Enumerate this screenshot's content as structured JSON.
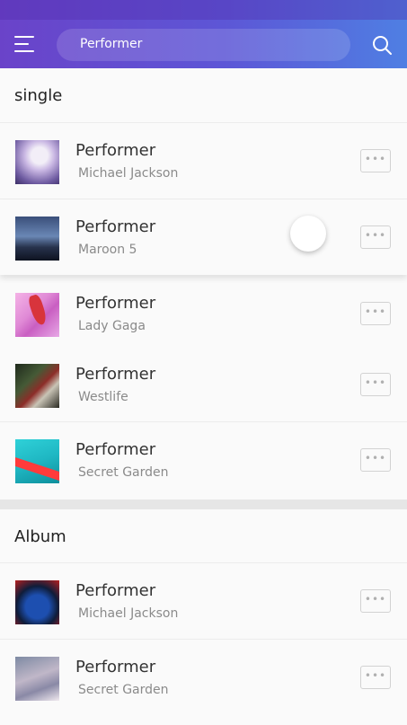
{
  "header": {
    "search_text": "Performer"
  },
  "sections": {
    "single_title": "single",
    "album_title": "Album"
  },
  "single": [
    {
      "title": "Performer",
      "artist": "Michael Jackson",
      "more": "•••"
    },
    {
      "title": "Performer",
      "artist": "Maroon 5",
      "more": "•••"
    },
    {
      "title": "Performer",
      "artist": "Lady Gaga",
      "more": "•••"
    },
    {
      "title": "Performer",
      "artist": "Westlife",
      "more": "•••"
    },
    {
      "title": "Performer",
      "artist": "Secret Garden",
      "more": "•••"
    }
  ],
  "album": [
    {
      "title": "Performer",
      "artist": "Michael Jackson",
      "more": "•••"
    },
    {
      "title": "Performer",
      "artist": "Secret Garden",
      "more": "•••"
    }
  ],
  "colors": {
    "header_start": "#6a43c9",
    "header_end": "#4f7fe3"
  }
}
